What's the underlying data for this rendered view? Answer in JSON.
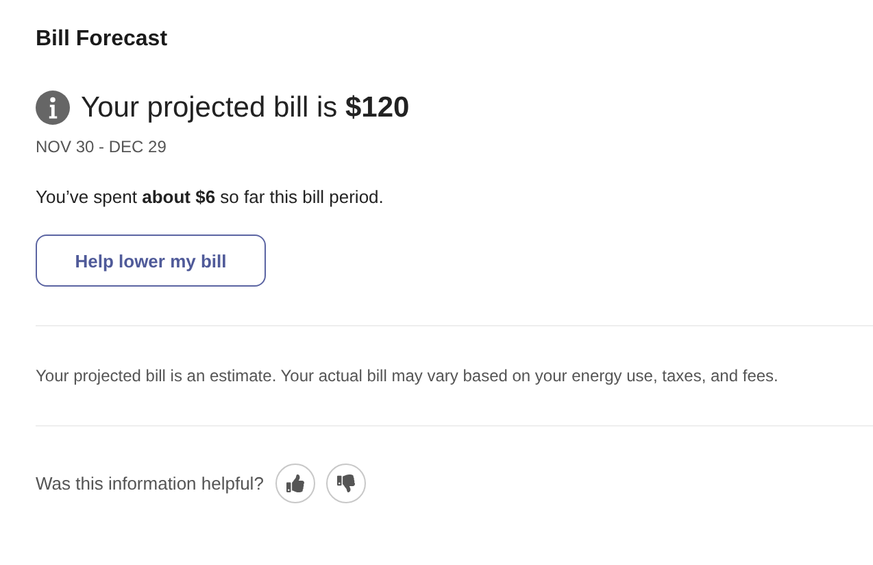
{
  "title": "Bill Forecast",
  "projection": {
    "headline": "Your projected bill is **$120**",
    "period": "NOV 30 - DEC 29",
    "spent": "You’ve spent **about $6** so far this bill period.",
    "button": "Help lower my bill"
  },
  "disclaimer": "Your projected bill is an estimate. Your actual bill may vary based on your energy use, taxes, and fees.",
  "feedback": {
    "question": "Was this information helpful?"
  }
}
